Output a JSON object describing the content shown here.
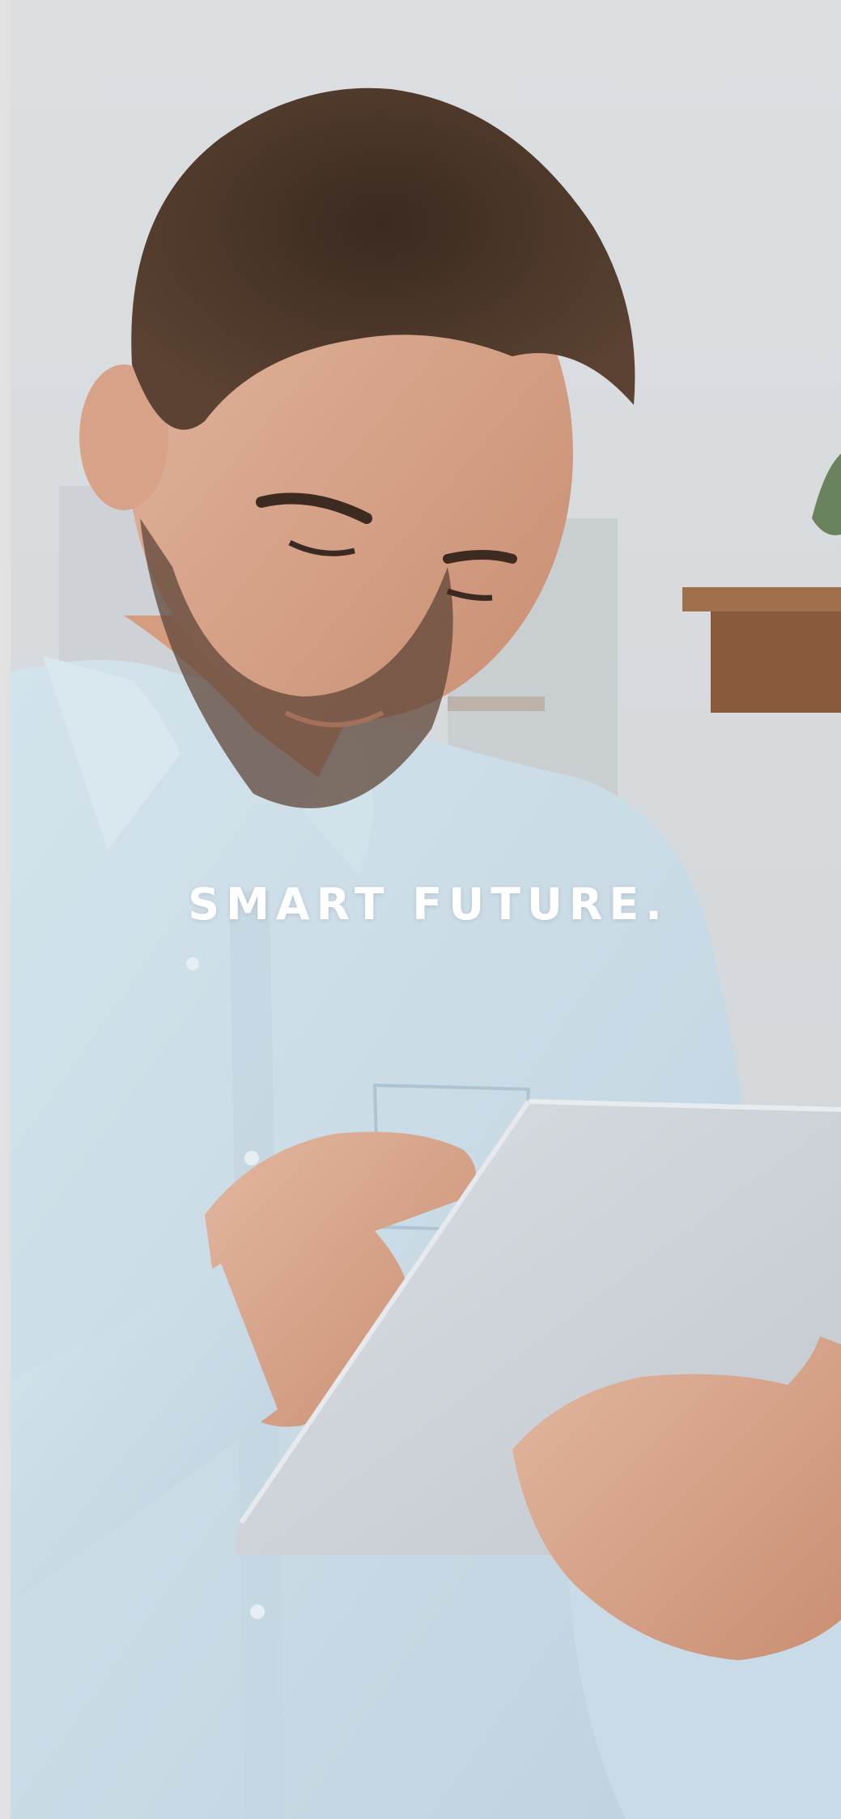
{
  "hero": {
    "headline": "SMART FUTURE.",
    "image": "man-using-tablet-photo"
  },
  "colors": {
    "background": "#d8dbde",
    "shirt": "#c9dbe6",
    "headline_text": "#ffffff",
    "shelf": "#8a5a3c"
  }
}
